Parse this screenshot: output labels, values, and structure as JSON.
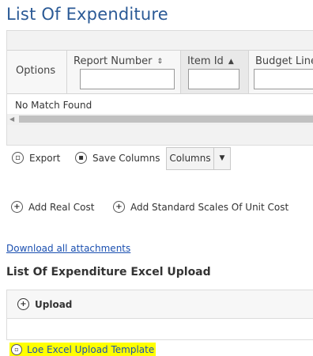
{
  "page": {
    "title": "List Of Expenditure"
  },
  "grid": {
    "columns": [
      {
        "label": "Options"
      },
      {
        "label": "Report Number",
        "sort_icon": "⇕"
      },
      {
        "label": "Item Id",
        "sort_icon": "▲"
      },
      {
        "label": "Budget Line"
      }
    ],
    "empty_message": "No Match Found"
  },
  "toolbar": {
    "export_label": "Export",
    "save_columns_label": "Save Columns",
    "columns_label": "Columns",
    "add_real_cost_label": "Add Real Cost",
    "add_standard_scales_label": "Add Standard Scales Of Unit Cost"
  },
  "links": {
    "download_all": "Download all attachments"
  },
  "upload_section": {
    "title": "List Of Expenditure Excel Upload",
    "upload_label": "Upload",
    "template_link": "Loe Excel Upload Template"
  },
  "colors": {
    "title": "#2b5a96",
    "link": "#1a4fb0",
    "highlight": "#ffff00"
  }
}
